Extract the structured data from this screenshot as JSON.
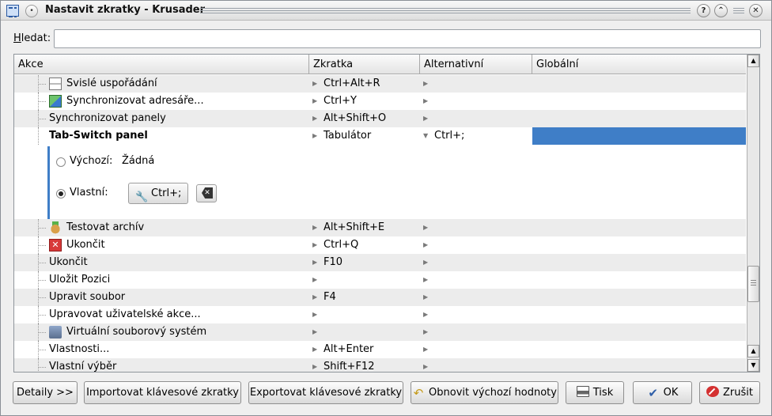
{
  "window": {
    "title": "Nastavit zkratky - Krusader",
    "help_glyph": "?",
    "shade_glyph": "⌃",
    "close_glyph": "✕",
    "menu_glyph": "•"
  },
  "search": {
    "label": "Hledat:",
    "value": "",
    "placeholder": ""
  },
  "columns": [
    "Akce",
    "Zkratka",
    "Alternativní",
    "Globální"
  ],
  "rows_top": [
    {
      "action": "Svislé uspořádání",
      "shortcut": "Ctrl+Alt+R",
      "alternative": "",
      "icon": "vertical-layout-icon"
    },
    {
      "action": "Synchronizovat adresáře...",
      "shortcut": "Ctrl+Y",
      "alternative": "",
      "icon": "sync-dirs-icon"
    },
    {
      "action": "Synchronizovat panely",
      "shortcut": "Alt+Shift+O",
      "alternative": ""
    }
  ],
  "selected_row": {
    "action": "Tab-Switch panel",
    "shortcut": "Tabulátor",
    "alternative": "Ctrl+;"
  },
  "editor": {
    "default_label": "Výchozí:",
    "default_value": "Žádná",
    "custom_label": "Vlastní:",
    "custom_shortcut": "Ctrl+;"
  },
  "rows_bottom": [
    {
      "action": "Testovat archív",
      "shortcut": "Alt+Shift+E",
      "alternative": "",
      "icon": "test-archive-icon"
    },
    {
      "action": "Ukončit",
      "shortcut": "Ctrl+Q",
      "alternative": "",
      "icon": "quit-icon"
    },
    {
      "action": "Ukončit",
      "shortcut": "F10",
      "alternative": ""
    },
    {
      "action": "Uložit Pozici",
      "shortcut": "",
      "alternative": ""
    },
    {
      "action": "Upravit soubor",
      "shortcut": "F4",
      "alternative": ""
    },
    {
      "action": "Upravovat uživatelské akce...",
      "shortcut": "",
      "alternative": ""
    },
    {
      "action": "Virtuální souborový systém",
      "shortcut": "",
      "alternative": "",
      "icon": "vfs-icon"
    },
    {
      "action": "Vlastnosti...",
      "shortcut": "Alt+Enter",
      "alternative": ""
    },
    {
      "action": "Vlastní výběr",
      "shortcut": "Shift+F12",
      "alternative": ""
    }
  ],
  "buttons": {
    "details": "Detaily >>",
    "import": "Importovat klávesové zkratky",
    "export": "Exportovat klávesové zkratky",
    "reset": "Obnovit výchozí hodnoty",
    "print": "Tisk",
    "ok": "OK",
    "cancel": "Zrušit"
  },
  "colors": {
    "selection": "#3f7ec7",
    "alt_row": "#ececec"
  }
}
